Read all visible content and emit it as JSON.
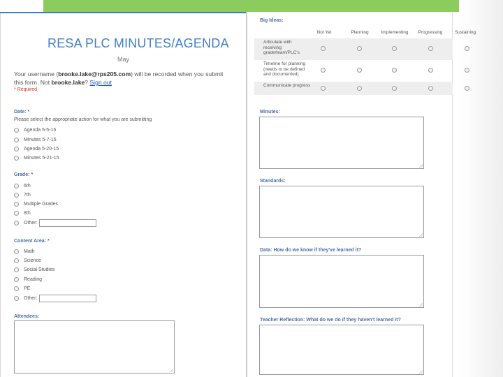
{
  "form": {
    "title": "RESA PLC MINUTES/AGENDA",
    "subtitle": "May",
    "user_prefix": "Your username (",
    "username": "brooke.lake@rps205.com",
    "user_mid": ") will be recorded when you submit this form. Not ",
    "user_short": "brooke.lake",
    "user_q": "? ",
    "sign_out": "Sign out",
    "required_note": "* Required"
  },
  "questions": {
    "date": {
      "label": "Date: *",
      "help": "Please select the appropriate action for what you are submitting",
      "options": [
        "Agenda 5-5-15",
        "Minutes 5-7-15",
        "Agenda 5-20-15",
        "Minutes 5-21-15"
      ]
    },
    "grade": {
      "label": "Grade: *",
      "options": [
        "6th",
        "7th",
        "Multiple Grades",
        "8th",
        "Other:"
      ]
    },
    "content_area": {
      "label": "Content Area: *",
      "options": [
        "Math",
        "Science",
        "Social Studies",
        "Reading",
        "PE",
        "Other:"
      ]
    },
    "attendees": {
      "label": "Attendees:"
    },
    "big_ideas": {
      "label": "Big Ideas:",
      "columns": [
        "Not Yet",
        "Planning",
        "Implementing",
        "Progressing",
        "Sustaining"
      ],
      "rows": [
        "Articulate with receiving grade/team/PLC's",
        "Timeline for planning (needs to be defined and documented)",
        "Communicate progress"
      ]
    },
    "minutes": {
      "label": "Minutes:"
    },
    "standards": {
      "label": "Standards:"
    },
    "data": {
      "label": "Data: How do we know if they've learned it?"
    },
    "reflection": {
      "label": "Teacher Reflection: What do we do if they haven't learned it?"
    }
  }
}
